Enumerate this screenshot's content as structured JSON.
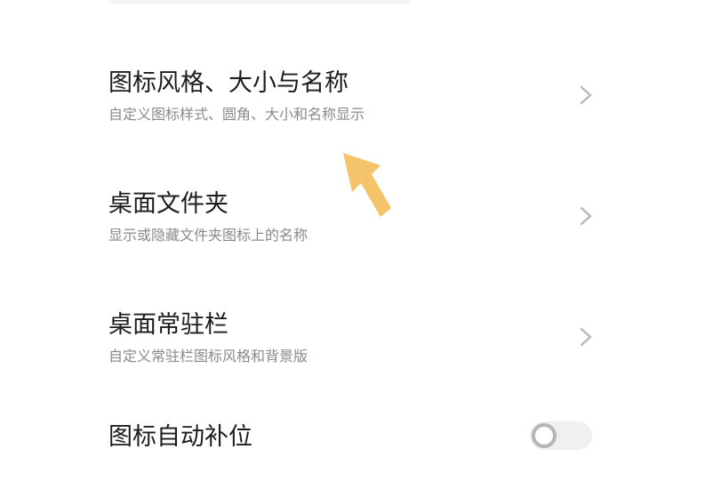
{
  "settings": {
    "items": [
      {
        "title": "图标风格、大小与名称",
        "subtitle": "自定义图标样式、圆角、大小和名称显示",
        "trailing_icon": "chevron-right-icon"
      },
      {
        "title": "桌面文件夹",
        "subtitle": "显示或隐藏文件夹图标上的名称",
        "trailing_icon": "chevron-right-icon"
      },
      {
        "title": "桌面常驻栏",
        "subtitle": "自定义常驻栏图标风格和背景版",
        "trailing_icon": "chevron-right-icon"
      },
      {
        "title": "图标自动补位",
        "toggle_on": false
      }
    ]
  },
  "annotation": {
    "icon": "pointer-arrow-icon",
    "color": "#F5C46A"
  },
  "colors": {
    "title": "#1C1C1C",
    "subtitle": "#8A8A8A",
    "chevron": "#B8B8B8",
    "toggle_track": "#F0F0F0",
    "toggle_knob_border": "#B5B5B5"
  }
}
